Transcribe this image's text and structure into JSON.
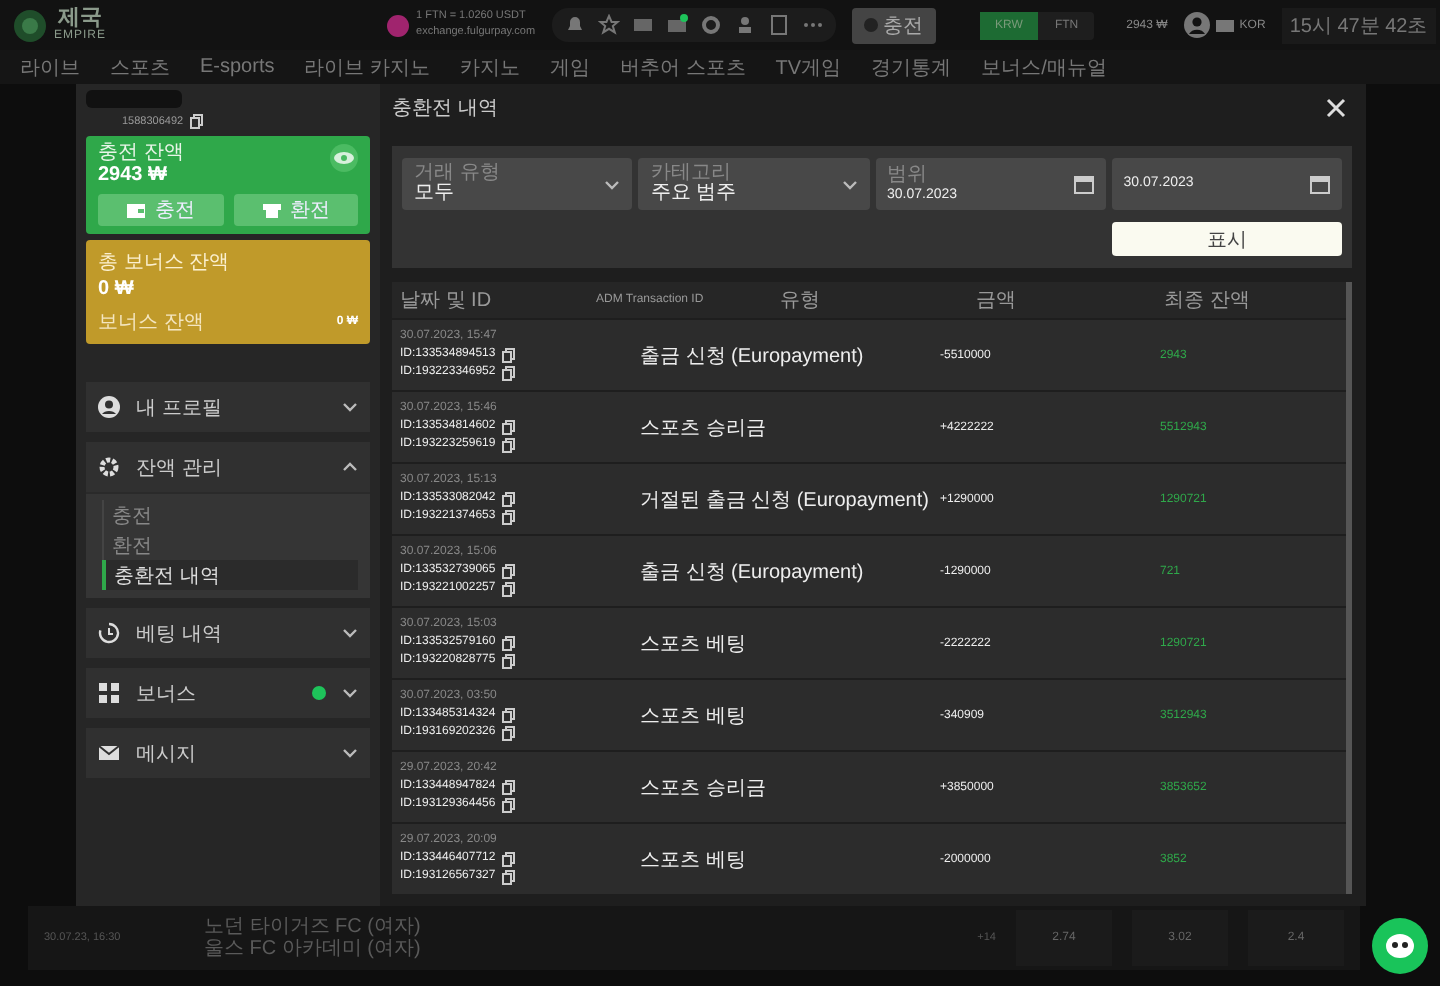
{
  "header": {
    "logo": {
      "title": "제국",
      "subtitle": "EMPIRE"
    },
    "rate": "1 FTN = 1.0260 USDT",
    "exchange": "exchange.fulgurpay.com",
    "deposit_button": "충전",
    "currencies": [
      {
        "label": "KRW",
        "selected": true
      },
      {
        "label": "FTN",
        "selected": false
      }
    ],
    "balance": "2943 ₩",
    "language": "KOR",
    "clock": "15시 47분 42초"
  },
  "nav": [
    "라이브",
    "스포츠",
    "E-sports",
    "라이브 카지노",
    "카지노",
    "게임",
    "버추어 스포츠",
    "TV게임",
    "경기통계",
    "보너스/매뉴얼"
  ],
  "match": {
    "time": "30.07.23, 16:30",
    "team_1": "노던 타이거즈 FC (여자)",
    "team_2": "울스 FC 아카데미 (여자)",
    "more": "+14",
    "odds": [
      "2.74",
      "3.02",
      "2.4"
    ]
  },
  "account": {
    "user_id": "1588306492",
    "cash": {
      "label": "충전 잔액",
      "amount": "2943 ₩",
      "buttons": [
        "충전",
        "환전"
      ]
    },
    "bonus": {
      "label": "총 보너스 잔액",
      "amount": "0 ₩",
      "detail_label": "보너스 잔액",
      "detail_amount": "0 ₩"
    }
  },
  "menu": [
    {
      "label": "내 프로필",
      "expanded": false,
      "notification": false
    },
    {
      "label": "잔액 관리",
      "expanded": true,
      "notification": false,
      "children": [
        {
          "label": "충전",
          "selected": false
        },
        {
          "label": "환전",
          "selected": false
        },
        {
          "label": "충환전 내역",
          "selected": true
        }
      ]
    },
    {
      "label": "베팅 내역",
      "expanded": false,
      "notification": false
    },
    {
      "label": "보너스",
      "expanded": false,
      "notification": true
    },
    {
      "label": "메시지",
      "expanded": false,
      "notification": false
    }
  ],
  "dialog": {
    "title": "충환전 내역",
    "filters": [
      {
        "kind": "select",
        "label": "거래 유형",
        "value": "모두"
      },
      {
        "kind": "select",
        "label": "카테고리",
        "value": "주요 범주"
      },
      {
        "kind": "date",
        "label": "범위",
        "value": "30.07.2023"
      },
      {
        "kind": "date",
        "value": "30.07.2023"
      }
    ],
    "show_button": "표시"
  },
  "table": {
    "columns": [
      "날짜 및 ID",
      "ADM Transaction ID",
      "유형",
      "금액",
      "최종 잔액"
    ],
    "rows": [
      {
        "date": "30.07.2023, 15:47",
        "ids": [
          "ID:133534894513",
          "ID:193223346952"
        ],
        "type": "출금 신청 (Europayment)",
        "amount": "-5510000",
        "balance": "2943"
      },
      {
        "date": "30.07.2023, 15:46",
        "ids": [
          "ID:133534814602",
          "ID:193223259619"
        ],
        "type": "스포츠 승리금",
        "amount": "+4222222",
        "balance": "5512943"
      },
      {
        "date": "30.07.2023, 15:13",
        "ids": [
          "ID:133533082042",
          "ID:193221374653"
        ],
        "type": "거절된 출금 신청 (Europayment)",
        "amount": "+1290000",
        "balance": "1290721"
      },
      {
        "date": "30.07.2023, 15:06",
        "ids": [
          "ID:133532739065",
          "ID:193221002257"
        ],
        "type": "출금 신청 (Europayment)",
        "amount": "-1290000",
        "balance": "721"
      },
      {
        "date": "30.07.2023, 15:03",
        "ids": [
          "ID:133532579160",
          "ID:193220828775"
        ],
        "type": "스포츠 베팅",
        "amount": "-2222222",
        "balance": "1290721"
      },
      {
        "date": "30.07.2023, 03:50",
        "ids": [
          "ID:133485314324",
          "ID:193169202326"
        ],
        "type": "스포츠 베팅",
        "amount": "-340909",
        "balance": "3512943"
      },
      {
        "date": "29.07.2023, 20:42",
        "ids": [
          "ID:133448947824",
          "ID:193129364456"
        ],
        "type": "스포츠 승리금",
        "amount": "+3850000",
        "balance": "3853652"
      },
      {
        "date": "29.07.2023, 20:09",
        "ids": [
          "ID:133446407712",
          "ID:193126567327"
        ],
        "type": "스포츠 베팅",
        "amount": "-2000000",
        "balance": "3852"
      }
    ]
  }
}
